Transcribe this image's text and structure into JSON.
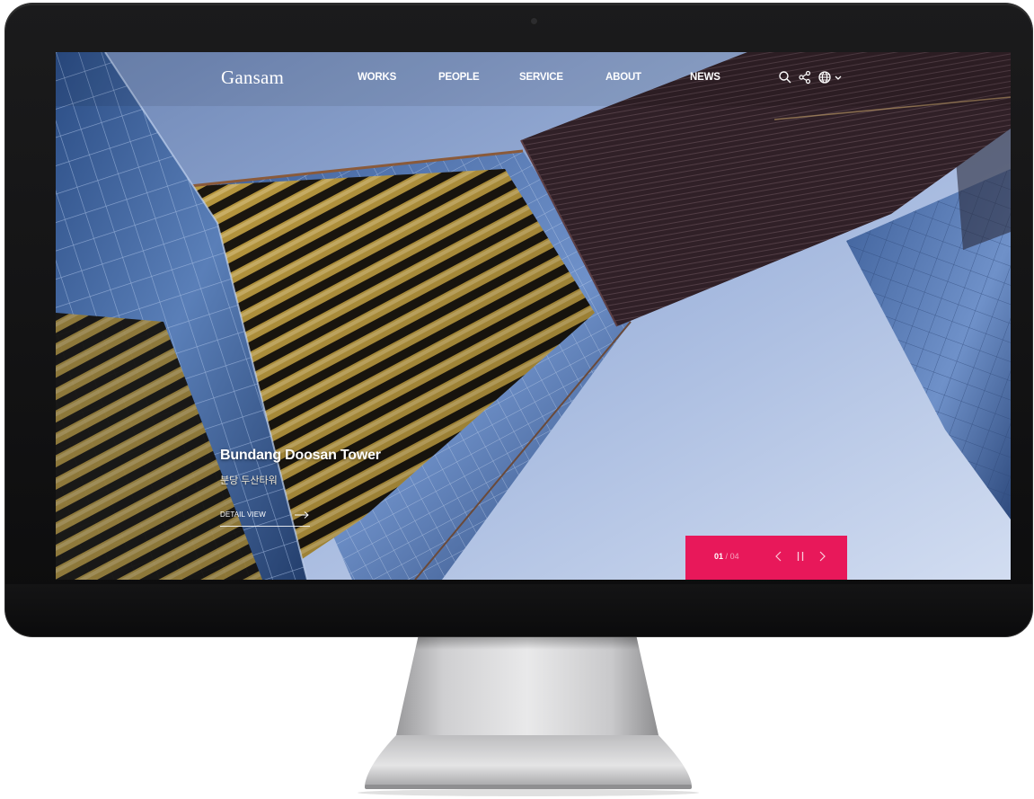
{
  "site": {
    "logo": "Gansam"
  },
  "nav": {
    "items": [
      {
        "label": "WORKS"
      },
      {
        "label": "PEOPLE"
      },
      {
        "label": "SERVICE"
      },
      {
        "label": "ABOUT"
      },
      {
        "label": "NEWS"
      }
    ]
  },
  "tools": {
    "icons": [
      "search-icon",
      "share-icon",
      "globe-icon",
      "chevron-down-icon"
    ]
  },
  "hero": {
    "title": "Bundang Doosan Tower",
    "subtitle": "분당 두산타워",
    "link_label": "DETAIL VIEW"
  },
  "slider": {
    "current": "01",
    "separator": "/",
    "total": "04",
    "icons": [
      "chevron-left-icon",
      "pause-icon",
      "chevron-right-icon"
    ]
  },
  "colors": {
    "accent": "#e8185a",
    "bezel": "#111112"
  }
}
